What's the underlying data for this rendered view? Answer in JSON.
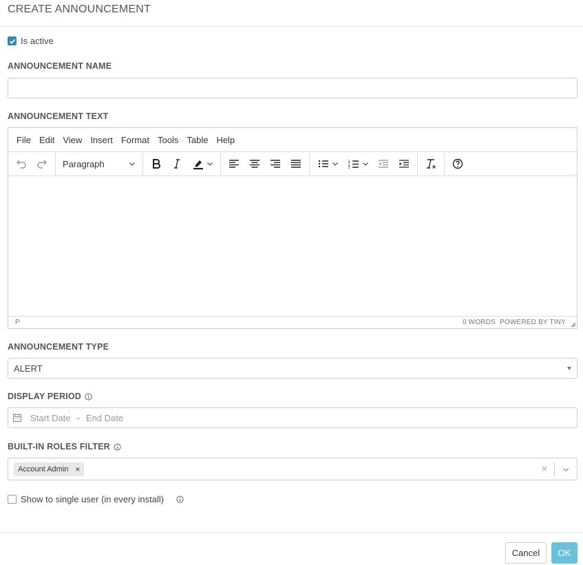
{
  "dialog": {
    "title": "CREATE ANNOUNCEMENT"
  },
  "is_active": {
    "label": "Is active",
    "checked": true
  },
  "announcement_name": {
    "label": "ANNOUNCEMENT NAME",
    "value": ""
  },
  "announcement_text": {
    "label": "ANNOUNCEMENT TEXT",
    "menu": [
      "File",
      "Edit",
      "View",
      "Insert",
      "Format",
      "Tools",
      "Table",
      "Help"
    ],
    "block_format": "Paragraph",
    "status_path": "P",
    "word_count": "0 WORDS",
    "powered_by": "POWERED BY TINY"
  },
  "announcement_type": {
    "label": "ANNOUNCEMENT TYPE",
    "value": "ALERT"
  },
  "display_period": {
    "label": "DISPLAY PERIOD",
    "start_placeholder": "Start Date",
    "separator": "-",
    "end_placeholder": "End Date"
  },
  "roles_filter": {
    "label": "BUILT-IN ROLES FILTER",
    "tags": [
      "Account Admin"
    ],
    "remove_glyph": "×",
    "clear_glyph": "×"
  },
  "single_user": {
    "label": "Show to single user (in every install)",
    "checked": false
  },
  "footer": {
    "cancel_label": "Cancel",
    "ok_label": "OK"
  },
  "colors": {
    "accent": "#2a8fb8",
    "ok_button": "#6cc1da"
  }
}
